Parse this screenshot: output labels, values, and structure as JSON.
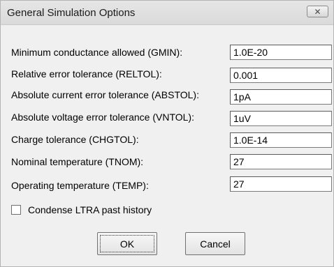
{
  "window": {
    "title": "General Simulation Options",
    "close_glyph": "✕"
  },
  "fields": [
    {
      "label": "Minimum conductance allowed (GMIN):",
      "value": "1.0E-20"
    },
    {
      "label": "Relative error tolerance (RELTOL):",
      "value": "0.001"
    },
    {
      "label": "Absolute current error tolerance (ABSTOL):",
      "value": "1pA"
    },
    {
      "label": "Absolute voltage error tolerance (VNTOL):",
      "value": "1uV"
    },
    {
      "label": "Charge tolerance (CHGTOL):",
      "value": "1.0E-14"
    },
    {
      "label": "Nominal temperature (TNOM):",
      "value": "27"
    },
    {
      "label": "Operating temperature (TEMP):",
      "value": "27"
    }
  ],
  "checkbox": {
    "label": "Condense LTRA past history",
    "checked": false
  },
  "buttons": {
    "ok_label": "OK",
    "cancel_label": "Cancel"
  }
}
